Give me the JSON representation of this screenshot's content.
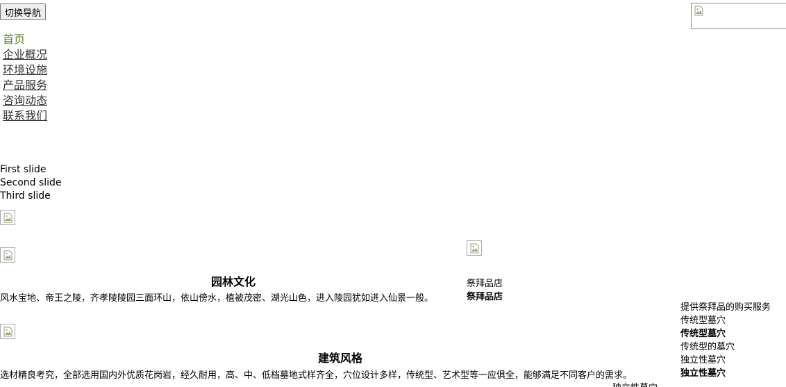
{
  "header": {
    "toggle_label": "切换导航"
  },
  "nav": {
    "items": [
      {
        "label": "首页",
        "active": true
      },
      {
        "label": "企业概况",
        "active": false
      },
      {
        "label": "环境设施",
        "active": false
      },
      {
        "label": "产品服务",
        "active": false
      },
      {
        "label": "咨询动态",
        "active": false
      },
      {
        "label": "联系我们",
        "active": false
      }
    ]
  },
  "carousel": {
    "slides": [
      "First slide",
      "Second slide",
      "Third slide"
    ]
  },
  "sections": [
    {
      "title": "园林文化",
      "desc": "风水宝地、帝王之陵，齐孝陵陵园三面环山，依山傍水，植被茂密、湖光山色，进入陵园犹如进入仙景一般。"
    },
    {
      "title": "建筑风格",
      "desc": "选材精良考究，全部选用国内外优质花岗岩，经久耐用，高、中、低档墓地式样齐全，穴位设计多样，传统型、艺术型等一应俱全，能够满足不同客户的需求。"
    }
  ],
  "shop": {
    "caption": "祭拜品店",
    "title": "祭拜品店",
    "desc": "提供祭拜品的购买服务"
  },
  "tombs": [
    {
      "caption": "传统型墓穴",
      "title": "传统型墓穴",
      "desc": "传统型的墓穴"
    },
    {
      "caption": "独立性墓穴",
      "title": "独立性墓穴",
      "desc": "独立性墓穴"
    }
  ],
  "colors": {
    "nav_active": "#5a8a1e",
    "nav_link": "#333333"
  }
}
